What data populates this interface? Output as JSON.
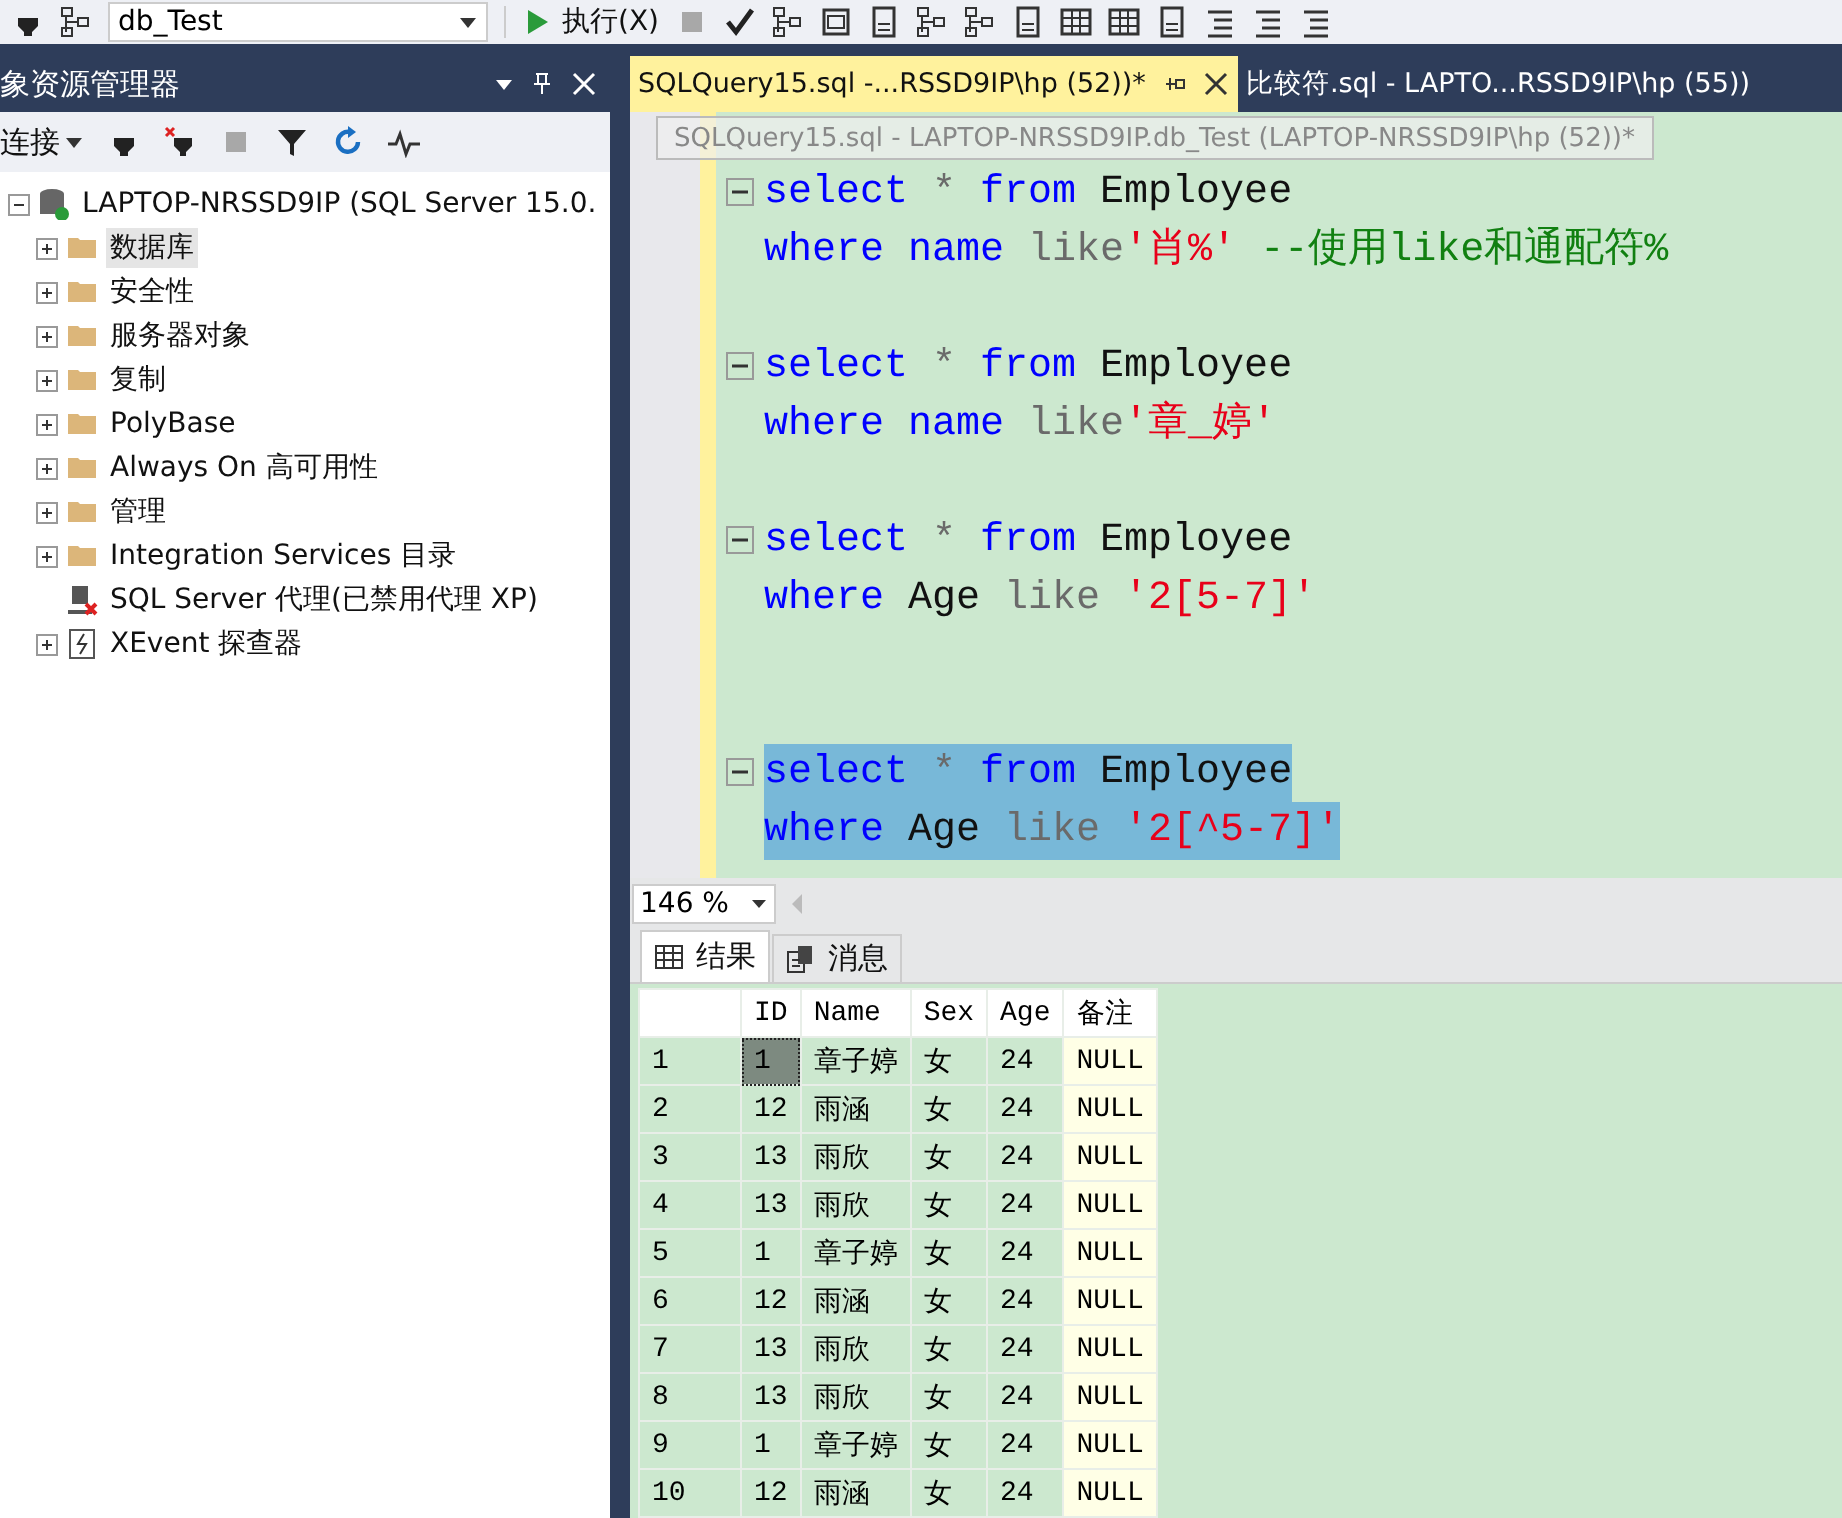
{
  "toolbar": {
    "database": "db_Test",
    "execute": "执行(X)"
  },
  "explorer": {
    "title": "象资源管理器",
    "connect": "连接",
    "root": {
      "label": "LAPTOP-NRSSD9IP (SQL Server 15.0.",
      "expanded": true,
      "children": [
        {
          "label": "数据库",
          "kind": "folder",
          "expandable": true,
          "selected": true
        },
        {
          "label": "安全性",
          "kind": "folder",
          "expandable": true,
          "selected": false
        },
        {
          "label": "服务器对象",
          "kind": "folder",
          "expandable": true,
          "selected": false
        },
        {
          "label": "复制",
          "kind": "folder",
          "expandable": true,
          "selected": false
        },
        {
          "label": "PolyBase",
          "kind": "folder",
          "expandable": true,
          "selected": false
        },
        {
          "label": "Always On 高可用性",
          "kind": "folder",
          "expandable": true,
          "selected": false
        },
        {
          "label": "管理",
          "kind": "folder",
          "expandable": true,
          "selected": false
        },
        {
          "label": "Integration Services 目录",
          "kind": "folder",
          "expandable": true,
          "selected": false
        },
        {
          "label": "SQL Server 代理(已禁用代理 XP)",
          "kind": "agent",
          "expandable": false,
          "selected": false
        },
        {
          "label": "XEvent 探查器",
          "kind": "xevent",
          "expandable": true,
          "selected": false
        }
      ]
    }
  },
  "tabs": [
    {
      "label": "SQLQuery15.sql -...RSSD9IP\\hp (52))*",
      "selected": true
    },
    {
      "label": "比较符.sql - LAPTO...RSSD9IP\\hp (55))",
      "selected": false
    }
  ],
  "tooltip": "SQLQuery15.sql - LAPTOP-NRSSD9IP.db_Test (LAPTOP-NRSSD9IP\\hp (52))*",
  "code": [
    {
      "fold": true,
      "selected": false,
      "tokens": [
        {
          "t": "select",
          "kind": "keyword"
        },
        {
          "t": " * ",
          "kind": "operator"
        },
        {
          "t": "from",
          "kind": "keyword"
        },
        {
          "t": " Employee",
          "kind": "plain"
        }
      ]
    },
    {
      "fold": false,
      "selected": false,
      "tokens": [
        {
          "t": "where",
          "kind": "keyword"
        },
        {
          "t": " name",
          "kind": "keyword"
        },
        {
          "t": " like",
          "kind": "operator"
        },
        {
          "t": "'肖%'",
          "kind": "string"
        },
        {
          "t": " --使用like和通配符%",
          "kind": "comment"
        }
      ]
    },
    {
      "fold": false,
      "selected": false
    },
    {
      "fold": true,
      "selected": false,
      "tokens": [
        {
          "t": "select",
          "kind": "keyword"
        },
        {
          "t": " * ",
          "kind": "operator"
        },
        {
          "t": "from",
          "kind": "keyword"
        },
        {
          "t": " Employee",
          "kind": "plain"
        }
      ]
    },
    {
      "fold": false,
      "selected": false,
      "tokens": [
        {
          "t": "where",
          "kind": "keyword"
        },
        {
          "t": " name",
          "kind": "keyword"
        },
        {
          "t": " like",
          "kind": "operator"
        },
        {
          "t": "'章_婷'",
          "kind": "string"
        }
      ]
    },
    {
      "fold": false,
      "selected": false
    },
    {
      "fold": true,
      "selected": false,
      "tokens": [
        {
          "t": "select",
          "kind": "keyword"
        },
        {
          "t": " * ",
          "kind": "operator"
        },
        {
          "t": "from",
          "kind": "keyword"
        },
        {
          "t": " Employee",
          "kind": "plain"
        }
      ]
    },
    {
      "fold": false,
      "selected": false,
      "tokens": [
        {
          "t": "where",
          "kind": "keyword"
        },
        {
          "t": " Age",
          "kind": "plain"
        },
        {
          "t": " like ",
          "kind": "operator"
        },
        {
          "t": "'2[5-7]'",
          "kind": "string"
        }
      ]
    },
    {
      "fold": false,
      "selected": false
    },
    {
      "fold": false,
      "selected": false
    },
    {
      "fold": true,
      "selected": true,
      "tokens": [
        {
          "t": "select",
          "kind": "keyword"
        },
        {
          "t": " * ",
          "kind": "operator"
        },
        {
          "t": "from",
          "kind": "keyword"
        },
        {
          "t": " Employee",
          "kind": "plain"
        }
      ]
    },
    {
      "fold": false,
      "selected": true,
      "tokens": [
        {
          "t": "where",
          "kind": "keyword"
        },
        {
          "t": " Age",
          "kind": "plain"
        },
        {
          "t": " like ",
          "kind": "operator"
        },
        {
          "t": "'2[^5-7]'",
          "kind": "string"
        }
      ]
    }
  ],
  "zoom": "146 %",
  "result_tabs": [
    {
      "label": "结果",
      "kind": "grid",
      "selected": true
    },
    {
      "label": "消息",
      "kind": "messages",
      "selected": false
    }
  ],
  "grid": {
    "columns": [
      {
        "label": "ID",
        "kind": "value"
      },
      {
        "label": "Name",
        "kind": "value"
      },
      {
        "label": "Sex",
        "kind": "value"
      },
      {
        "label": "Age",
        "kind": "value"
      },
      {
        "label": "备注",
        "kind": "null"
      }
    ],
    "rows": [
      {
        "number": "1",
        "focused": true,
        "cells": [
          "1",
          "章子婷",
          "女",
          "24",
          "NULL"
        ]
      },
      {
        "number": "2",
        "focused": false,
        "cells": [
          "12",
          "雨涵",
          "女",
          "24",
          "NULL"
        ]
      },
      {
        "number": "3",
        "focused": false,
        "cells": [
          "13",
          "雨欣",
          "女",
          "24",
          "NULL"
        ]
      },
      {
        "number": "4",
        "focused": false,
        "cells": [
          "13",
          "雨欣",
          "女",
          "24",
          "NULL"
        ]
      },
      {
        "number": "5",
        "focused": false,
        "cells": [
          "1",
          "章子婷",
          "女",
          "24",
          "NULL"
        ]
      },
      {
        "number": "6",
        "focused": false,
        "cells": [
          "12",
          "雨涵",
          "女",
          "24",
          "NULL"
        ]
      },
      {
        "number": "7",
        "focused": false,
        "cells": [
          "13",
          "雨欣",
          "女",
          "24",
          "NULL"
        ]
      },
      {
        "number": "8",
        "focused": false,
        "cells": [
          "13",
          "雨欣",
          "女",
          "24",
          "NULL"
        ]
      },
      {
        "number": "9",
        "focused": false,
        "cells": [
          "1",
          "章子婷",
          "女",
          "24",
          "NULL"
        ]
      },
      {
        "number": "10",
        "focused": false,
        "cells": [
          "12",
          "雨涵",
          "女",
          "24",
          "NULL"
        ]
      }
    ]
  }
}
